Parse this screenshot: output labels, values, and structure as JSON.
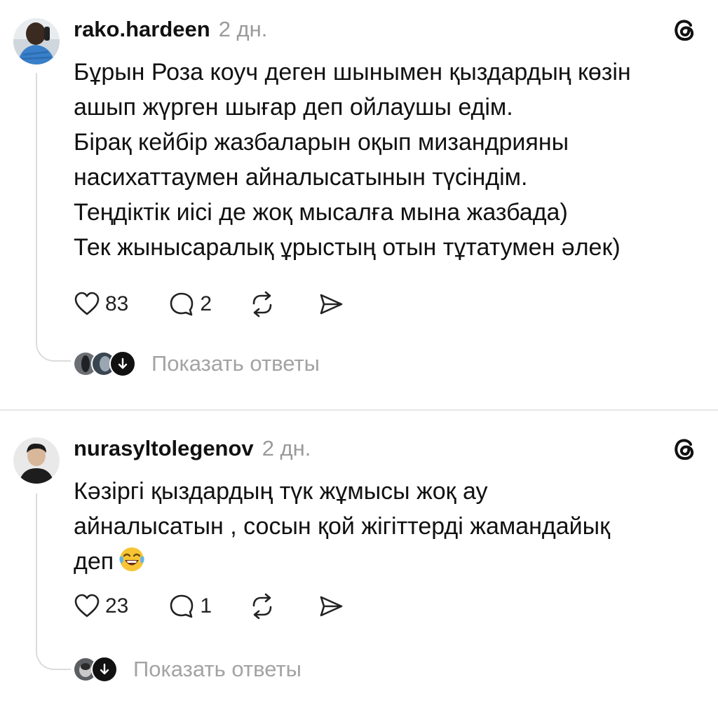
{
  "posts": [
    {
      "username": "rako.hardeen",
      "time": "2 дн.",
      "lines": [
        "Бұрын Роза коуч деген шынымен қыздардың көзін",
        "ашып жүрген шығар деп ойлаушы едім.",
        "Бірақ кейбір жазбаларын оқып мизандрияны",
        "насихаттаумен айналысатынын түсіндім.",
        "Теңдіктік иісі де жоқ мысалға мына жазбада)",
        "Тек жынысаралық ұрыстың отын тұтатумен әлек)"
      ],
      "likes": "83",
      "comments": "2",
      "show_replies": "Показать ответы"
    },
    {
      "username": "nurasyltolegenov",
      "time": "2 дн.",
      "lines": [
        "Кәзіргі қыздардың түк жұмысы жоқ ау",
        "айналысатын , сосын қой жігіттерді жамандайық",
        "деп"
      ],
      "emoji": "face-with-tears-of-joy",
      "likes": "23",
      "comments": "1",
      "show_replies": "Показать ответы"
    }
  ],
  "icons": {
    "like": "heart-icon",
    "comment": "comment-bubble-icon",
    "repost": "repost-icon",
    "share": "send-icon",
    "threads": "threads-logo-icon",
    "replies": "arrow-down-icon"
  },
  "colors": {
    "text": "#111111",
    "muted": "#9a9a9a",
    "thread_line": "#dcdcdc"
  }
}
